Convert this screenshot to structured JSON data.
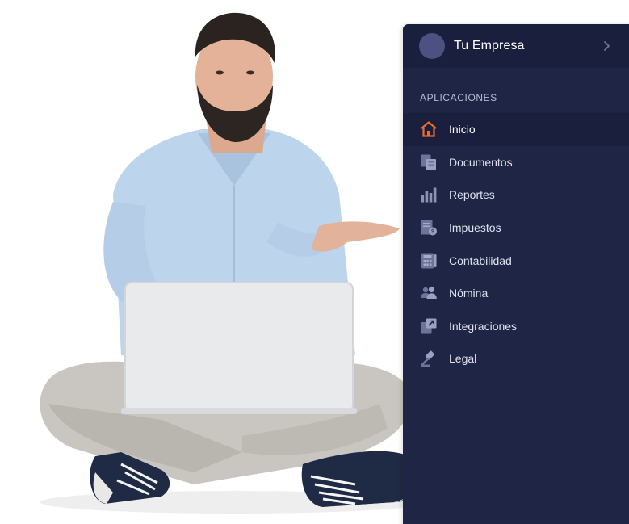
{
  "company": {
    "name": "Tu Empresa"
  },
  "sidebar": {
    "section_title": "APLICACIONES",
    "items": [
      {
        "label": "Inicio",
        "icon": "home-icon",
        "active": true
      },
      {
        "label": "Documentos",
        "icon": "documents-icon",
        "active": false
      },
      {
        "label": "Reportes",
        "icon": "bar-chart-icon",
        "active": false
      },
      {
        "label": "Impuestos",
        "icon": "tax-icon",
        "active": false
      },
      {
        "label": "Contabilidad",
        "icon": "calculator-icon",
        "active": false
      },
      {
        "label": "Nómina",
        "icon": "people-icon",
        "active": false
      },
      {
        "label": "Integraciones",
        "icon": "integrations-icon",
        "active": false
      },
      {
        "label": "Legal",
        "icon": "gavel-icon",
        "active": false
      }
    ]
  },
  "colors": {
    "panel_bg": "#1f2545",
    "header_bg": "#1a1f3d",
    "active_icon": "#f26b2a",
    "icon_muted": "#8d93b4"
  }
}
